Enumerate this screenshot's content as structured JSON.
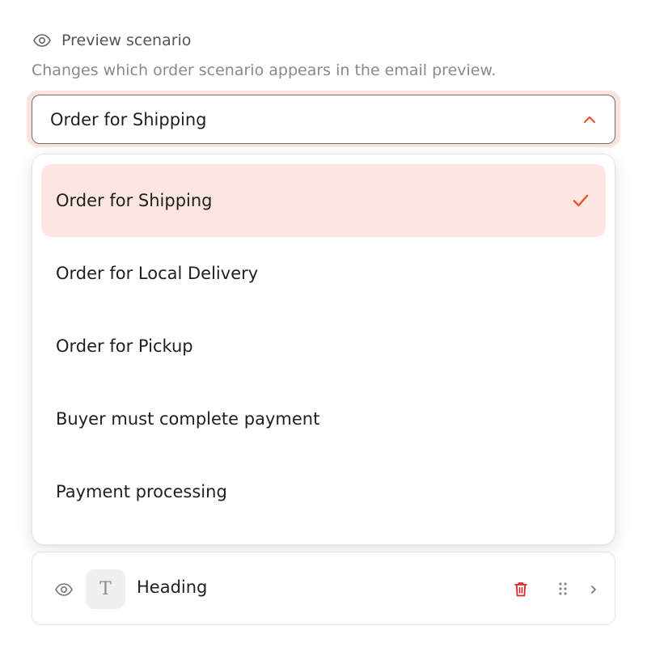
{
  "section": {
    "title": "Preview scenario",
    "help": "Changes which order scenario appears in the email preview.",
    "icon": "eye-icon"
  },
  "select": {
    "value": "Order for Shipping",
    "expanded": true,
    "focus_ring_color": "#fde2de",
    "accent_color": "#e8502f"
  },
  "menu": {
    "items": [
      {
        "label": "Order for Shipping",
        "selected": true
      },
      {
        "label": "Order for Local Delivery",
        "selected": false
      },
      {
        "label": "Order for Pickup",
        "selected": false
      },
      {
        "label": "Buyer must complete payment",
        "selected": false
      },
      {
        "label": "Payment processing",
        "selected": false
      }
    ],
    "selected_bg": "#fde6e1"
  },
  "block": {
    "title": "Heading",
    "type_glyph": "T",
    "icons": [
      "eye-icon",
      "trash-icon",
      "drag-handle-icon",
      "chevron-right-icon"
    ],
    "trash_color": "#d9262c"
  }
}
